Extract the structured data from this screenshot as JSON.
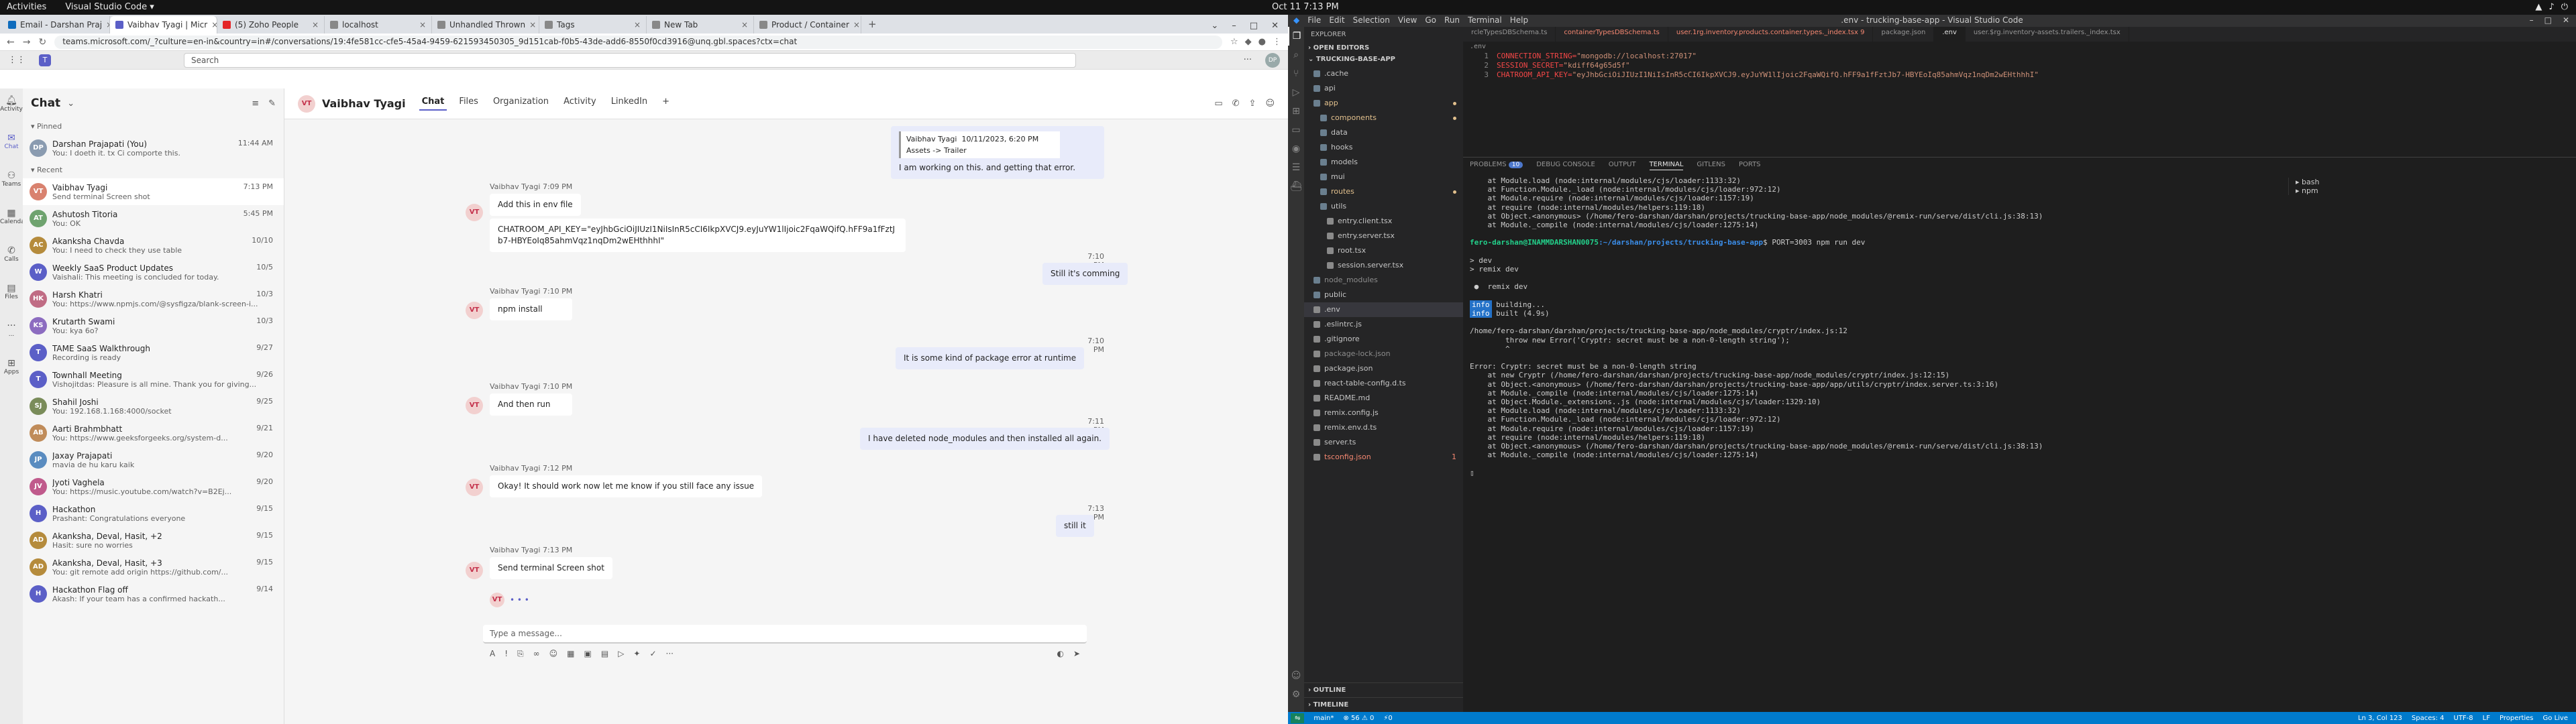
{
  "topbar": {
    "activities": "Activities",
    "app": "Visual Studio Code ▾",
    "clock": "Oct 11  7:13 PM"
  },
  "browser": {
    "tabs": [
      {
        "label": "Email - Darshan Praj",
        "color": "#0f6cbd"
      },
      {
        "label": "Vaibhav Tyagi | Micr",
        "color": "#5b5fc7",
        "active": true
      },
      {
        "label": "(5) Zoho People",
        "color": "#e42527"
      },
      {
        "label": "localhost",
        "color": "#888888"
      },
      {
        "label": "Unhandled Thrown",
        "color": "#888888"
      },
      {
        "label": "Tags",
        "color": "#888888"
      },
      {
        "label": "New Tab",
        "color": "#888888"
      },
      {
        "label": "Product / Container",
        "color": "#888888"
      }
    ],
    "url": "teams.microsoft.com/_?culture=en-in&country=in#/conversations/19:4fe581cc-cfe5-45a4-9459-621593450305_9d151cab-f0b5-43de-add6-8550f0cd3916@unq.gbl.spaces?ctx=chat"
  },
  "teams": {
    "search_placeholder": "Search",
    "avatar_initials": "DP",
    "rail": [
      {
        "label": "Activity",
        "icon": "bell-icon"
      },
      {
        "label": "Chat",
        "icon": "chat-icon",
        "active": true
      },
      {
        "label": "Teams",
        "icon": "teams-icon"
      },
      {
        "label": "Calendar",
        "icon": "calendar-icon"
      },
      {
        "label": "Calls",
        "icon": "phone-icon"
      },
      {
        "label": "Files",
        "icon": "file-icon"
      },
      {
        "label": "...",
        "icon": "more-icon"
      },
      {
        "label": "Apps",
        "icon": "apps-icon"
      }
    ],
    "chat_title": "Chat",
    "pinned_label": "Pinned",
    "recent_label": "Recent",
    "pinned": [
      {
        "name": "Darshan Prajapati (You)",
        "preview": "You: I doeth it. tx Ci comporte this.",
        "time": "11:44 AM",
        "initials": "DP",
        "color": "#8a9bb0"
      }
    ],
    "recent": [
      {
        "name": "Vaibhav Tyagi",
        "preview": "Send terminal Screen shot",
        "time": "7:13 PM",
        "initials": "VT",
        "color": "#d9826f",
        "active": true
      },
      {
        "name": "Ashutosh Titoria",
        "preview": "You: OK",
        "time": "5:45 PM",
        "initials": "AT",
        "color": "#6fa36f"
      },
      {
        "name": "Akanksha Chavda",
        "preview": "You: I need to check they use table",
        "time": "10/10",
        "initials": "AC",
        "color": "#b58b3c"
      },
      {
        "name": "Weekly SaaS Product Updates",
        "preview": "Vaishali: This meeting is concluded for today.",
        "time": "10/5",
        "initials": "W",
        "color": "#5b5fc7"
      },
      {
        "name": "Harsh Khatri",
        "preview": "You: https://www.npmjs.com/@sysfigza/blank-screen-i...",
        "time": "10/3",
        "initials": "HK",
        "color": "#c06c84"
      },
      {
        "name": "Krutarth Swami",
        "preview": "You: kya 6o?",
        "time": "10/3",
        "initials": "KS",
        "color": "#8c6cc0"
      },
      {
        "name": "TAME SaaS Walkthrough",
        "preview": "Recording is ready",
        "time": "9/27",
        "initials": "T",
        "color": "#5b5fc7"
      },
      {
        "name": "Townhall Meeting",
        "preview": "Vishojitdas: Pleasure is all mine. Thank you for giving...",
        "time": "9/26",
        "initials": "T",
        "color": "#5b5fc7"
      },
      {
        "name": "Shahil Joshi",
        "preview": "You: 192.168.1.168:4000/socket",
        "time": "9/25",
        "initials": "SJ",
        "color": "#7a8c5a"
      },
      {
        "name": "Aarti Brahmbhatt",
        "preview": "You: https://www.geeksforgeeks.org/system-d...",
        "time": "9/21",
        "initials": "AB",
        "color": "#c08c5a"
      },
      {
        "name": "Jaxay Prajapati",
        "preview": "mavia de hu karu kaik",
        "time": "9/20",
        "initials": "JP",
        "color": "#5a8cc0"
      },
      {
        "name": "Jyoti Vaghela",
        "preview": "You: https://music.youtube.com/watch?v=B2Ej...",
        "time": "9/20",
        "initials": "JV",
        "color": "#c05a8c"
      },
      {
        "name": "Hackathon",
        "preview": "Prashant: Congratulations everyone",
        "time": "9/15",
        "initials": "H",
        "color": "#5b5fc7"
      },
      {
        "name": "Akanksha, Deval, Hasit, +2",
        "preview": "Hasit: sure no worries",
        "time": "9/15",
        "initials": "AD",
        "color": "#b58b3c"
      },
      {
        "name": "Akanksha, Deval, Hasit, +3",
        "preview": "You: git remote add origin https://github.com/...",
        "time": "9/15",
        "initials": "AD",
        "color": "#b58b3c"
      },
      {
        "name": "Hackathon Flag off",
        "preview": "Akash: If your team has a confirmed hackath...",
        "time": "9/14",
        "initials": "H",
        "color": "#5b5fc7"
      }
    ],
    "header": {
      "name": "Vaibhav Tyagi",
      "initials": "VT",
      "tabs": [
        "Chat",
        "Files",
        "Organization",
        "Activity",
        "LinkedIn",
        "+"
      ]
    },
    "messages": {
      "quote_author": "Vaibhav Tyagi",
      "quote_time": "10/11/2023, 6:20 PM",
      "quote_text": "Assets -> Trailer",
      "quote_reply": "I am working on this. and getting that error.",
      "m1_meta": "Vaibhav Tyagi  7:09 PM",
      "m1": "Add this in env file",
      "m2": "CHATROOM_API_KEY=\"eyJhbGciOiJIUzI1NiIsInR5cCI6IkpXVCJ9.eyJuYW1lIjoic2FqaWQifQ.hFF9a1fFztJb7-HBYEoIq85ahmVqz1nqDm2wEHthhhI\"",
      "m3_time": "7:10 PM",
      "m3": "Still it's comming",
      "m4_meta": "Vaibhav Tyagi  7:10 PM",
      "m4": "npm install",
      "m5_time": "7:10 PM",
      "m5": "It is some kind of package error at runtime",
      "m6_meta": "Vaibhav Tyagi  7:10 PM",
      "m6": "And then run",
      "m7_time": "7:11 PM",
      "m7": "I have deleted node_modules and then installed all again.",
      "m8_meta": "Vaibhav Tyagi  7:12 PM",
      "m8": "Okay! It should work now let me know if you still face any issue",
      "m9_time": "7:13 PM",
      "m9": "still it",
      "m10_meta": "Vaibhav Tyagi  7:13 PM",
      "m10": "Send terminal Screen shot",
      "typing": "• • •"
    },
    "compose_placeholder": "Type a message..."
  },
  "vscode": {
    "title": ".env - trucking-base-app - Visual Studio Code",
    "menu": [
      "File",
      "Edit",
      "Selection",
      "View",
      "Go",
      "Run",
      "Terminal",
      "Help"
    ],
    "explorer_label": "EXPLORER",
    "open_editors": "OPEN EDITORS",
    "project": "TRUCKING-BASE-APP",
    "tree": [
      {
        "name": ".cache",
        "indent": 1,
        "type": "folder",
        "color": "#c5c5c5"
      },
      {
        "name": "api",
        "indent": 1,
        "type": "folder",
        "color": "#c5c5c5"
      },
      {
        "name": "app",
        "indent": 1,
        "type": "folder",
        "color": "#e2c08d",
        "dot": "#e2c08d"
      },
      {
        "name": "components",
        "indent": 2,
        "type": "folder",
        "color": "#e2c08d",
        "dot": "#e2c08d"
      },
      {
        "name": "data",
        "indent": 2,
        "type": "folder",
        "color": "#c5c5c5"
      },
      {
        "name": "hooks",
        "indent": 2,
        "type": "folder",
        "color": "#c5c5c5"
      },
      {
        "name": "models",
        "indent": 2,
        "type": "folder",
        "color": "#c5c5c5"
      },
      {
        "name": "mui",
        "indent": 2,
        "type": "folder",
        "color": "#c5c5c5"
      },
      {
        "name": "routes",
        "indent": 2,
        "type": "folder",
        "color": "#e2c08d",
        "dot": "#e2c08d"
      },
      {
        "name": "utils",
        "indent": 2,
        "type": "folder",
        "color": "#c5c5c5"
      },
      {
        "name": "entry.client.tsx",
        "indent": 3,
        "type": "file",
        "color": "#c5c5c5"
      },
      {
        "name": "entry.server.tsx",
        "indent": 3,
        "type": "file",
        "color": "#c5c5c5"
      },
      {
        "name": "root.tsx",
        "indent": 3,
        "type": "file",
        "color": "#c5c5c5"
      },
      {
        "name": "session.server.tsx",
        "indent": 3,
        "type": "file",
        "color": "#c5c5c5"
      },
      {
        "name": "node_modules",
        "indent": 1,
        "type": "folder",
        "color": "#8c8c8c"
      },
      {
        "name": "public",
        "indent": 1,
        "type": "folder",
        "color": "#c5c5c5"
      },
      {
        "name": ".env",
        "indent": 1,
        "type": "file",
        "color": "#c5c5c5",
        "selected": true
      },
      {
        "name": ".eslintrc.js",
        "indent": 1,
        "type": "file",
        "color": "#c5c5c5"
      },
      {
        "name": ".gitignore",
        "indent": 1,
        "type": "file",
        "color": "#c5c5c5"
      },
      {
        "name": "package-lock.json",
        "indent": 1,
        "type": "file",
        "color": "#8c8c8c"
      },
      {
        "name": "package.json",
        "indent": 1,
        "type": "file",
        "color": "#c5c5c5"
      },
      {
        "name": "react-table-config.d.ts",
        "indent": 1,
        "type": "file",
        "color": "#c5c5c5"
      },
      {
        "name": "README.md",
        "indent": 1,
        "type": "file",
        "color": "#c5c5c5"
      },
      {
        "name": "remix.config.js",
        "indent": 1,
        "type": "file",
        "color": "#c5c5c5"
      },
      {
        "name": "remix.env.d.ts",
        "indent": 1,
        "type": "file",
        "color": "#c5c5c5"
      },
      {
        "name": "server.ts",
        "indent": 1,
        "type": "file",
        "color": "#c5c5c5"
      },
      {
        "name": "tsconfig.json",
        "indent": 1,
        "type": "file",
        "color": "#f48771",
        "badge": "1"
      }
    ],
    "outline": "OUTLINE",
    "timeline": "TIMELINE",
    "tabs": [
      {
        "label": "rcleTypesDBSchema.ts",
        "cls": ""
      },
      {
        "label": "containerTypesDBSchema.ts",
        "cls": "err"
      },
      {
        "label": "user.1rg.inventory.products.container.types._index.tsx  9",
        "cls": "err"
      },
      {
        "label": "package.json",
        "cls": ""
      },
      {
        "label": ".env",
        "cls": "active"
      },
      {
        "label": "user.$rg.inventory-assets.trailers._index.tsx",
        "cls": ""
      }
    ],
    "breadcrumb": ".env",
    "code": [
      {
        "n": "1",
        "k": "CONNECTION_STRING=",
        "v": "\"mongodb://localhost:27017\""
      },
      {
        "n": "2",
        "k": "SESSION_SECRET=",
        "v": "\"kdiff64g65d5f\""
      },
      {
        "n": "3",
        "k": "CHATROOM_API_KEY=",
        "v": "\"eyJhbGciOiJIUzI1NiIsInR5cCI6IkpXVCJ9.eyJuYW1lIjoic2FqaWQifQ.hFF9a1fFztJb7-HBYEoIq85ahmVqz1nqDm2wEHthhhI\""
      }
    ],
    "panel_tabs": [
      "PROBLEMS",
      "DEBUG CONSOLE",
      "OUTPUT",
      "TERMINAL",
      "GITLENS",
      "PORTS"
    ],
    "problems_count": "10",
    "term_lines": [
      "    at Module.load (node:internal/modules/cjs/loader:1133:32)",
      "    at Function.Module._load (node:internal/modules/cjs/loader:972:12)",
      "    at Module.require (node:internal/modules/cjs/loader:1157:19)",
      "    at require (node:internal/modules/helpers:119:18)",
      "    at Object.<anonymous> (/home/fero-darshan/darshan/projects/trucking-base-app/node_modules/@remix-run/serve/dist/cli.js:38:13)",
      "    at Module._compile (node:internal/modules/cjs/loader:1275:14)"
    ],
    "prompt_user": "fero-darshan@INAMMDARSHAN0075",
    "prompt_path": ":~/darshan/projects/trucking-base-app",
    "prompt_cmd": "$ PORT=3003 npm run dev",
    "term_lines2": [
      "> dev",
      "> remix dev",
      "",
      " ●  remix dev"
    ],
    "info1": "building...",
    "info2": "built (4.9s)",
    "term_lines3": [
      "/home/fero-darshan/darshan/projects/trucking-base-app/node_modules/cryptr/index.js:12",
      "        throw new Error('Cryptr: secret must be a non-0-length string');",
      "        ^",
      "",
      "Error: Cryptr: secret must be a non-0-length string",
      "    at new Cryptr (/home/fero-darshan/darshan/projects/trucking-base-app/node_modules/cryptr/index.js:12:15)",
      "    at Object.<anonymous> (/home/fero-darshan/darshan/projects/trucking-base-app/app/utils/cryptr/index.server.ts:3:16)",
      "    at Module._compile (node:internal/modules/cjs/loader:1275:14)",
      "    at Object.Module._extensions..js (node:internal/modules/cjs/loader:1329:10)",
      "    at Module.load (node:internal/modules/cjs/loader:1133:32)",
      "    at Function.Module._load (node:internal/modules/cjs/loader:972:12)",
      "    at Module.require (node:internal/modules/cjs/loader:1157:19)",
      "    at require (node:internal/modules/helpers:119:18)",
      "    at Object.<anonymous> (/home/fero-darshan/darshan/projects/trucking-base-app/node_modules/@remix-run/serve/dist/cli.js:38:13)",
      "    at Module._compile (node:internal/modules/cjs/loader:1275:14)"
    ],
    "term_list": [
      "bash",
      "npm"
    ],
    "status_left": [
      "main*",
      "⊗ 56 ⚠ 0",
      "⚡0"
    ],
    "status_right": [
      "Ln 3, Col 123",
      "Spaces: 4",
      "UTF-8",
      "LF",
      "Properties",
      "Go Live"
    ]
  }
}
